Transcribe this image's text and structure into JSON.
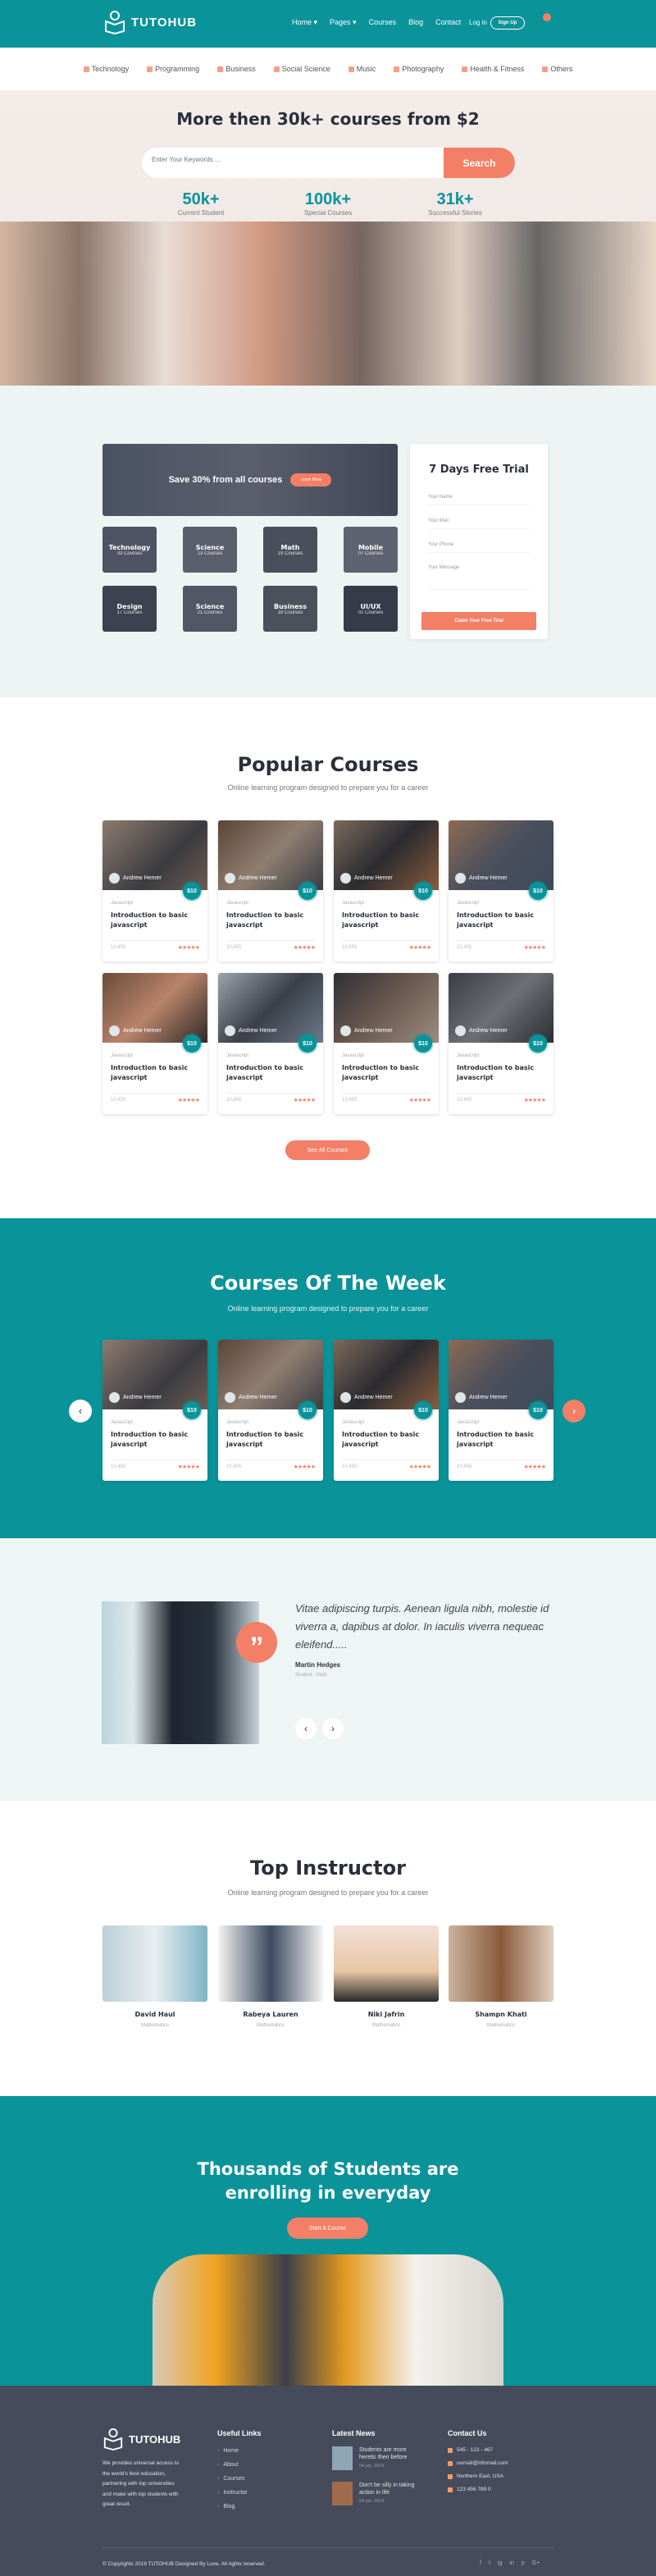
{
  "colors": {
    "teal": "#0a9399",
    "coral": "#f37f66",
    "footer": "#454b5a"
  },
  "header": {
    "logo": "TUTOHUB",
    "nav": [
      "Home ▾",
      "Pages ▾",
      "Courses",
      "Blog",
      "Contact"
    ],
    "login": "Log in",
    "signup": "Sign Up",
    "cart_icon": "cart-icon"
  },
  "categories": [
    {
      "label": "Technology",
      "icon": "laptop-icon"
    },
    {
      "label": "Programming",
      "icon": "monitor-icon"
    },
    {
      "label": "Business",
      "icon": "dollar-icon"
    },
    {
      "label": "Social Science",
      "icon": "globe-icon"
    },
    {
      "label": "Music",
      "icon": "music-icon"
    },
    {
      "label": "Photography",
      "icon": "camera-icon"
    },
    {
      "label": "Health & Fitness",
      "icon": "heart-icon"
    },
    {
      "label": "Others",
      "icon": "grid-icon"
    }
  ],
  "hero": {
    "title": "More then 30k+ courses from $2",
    "search_placeholder": "Enter Your Keywords ...",
    "search_button": "Search",
    "stats": [
      {
        "value": "50k+",
        "label": "Current Student"
      },
      {
        "value": "100k+",
        "label": "Special Courses"
      },
      {
        "value": "31k+",
        "label": "Successful Stories"
      }
    ]
  },
  "promo": {
    "banner_text": "Save 30% from all courses",
    "banner_button": "Learn More",
    "tiles": [
      {
        "name": "Technology",
        "count": "33 Courses"
      },
      {
        "name": "Science",
        "count": "13 Courses"
      },
      {
        "name": "Math",
        "count": "19 Courses"
      },
      {
        "name": "Mobile",
        "count": "07 Courses"
      },
      {
        "name": "Design",
        "count": "17 Courses"
      },
      {
        "name": "Science",
        "count": "21 Courses"
      },
      {
        "name": "Business",
        "count": "18 Courses"
      },
      {
        "name": "UI/UX",
        "count": "02 Courses"
      }
    ]
  },
  "trial": {
    "title": "7 Days Free Trial",
    "fields": [
      "Your Name",
      "Your Mail",
      "Your Phone",
      "Your Message"
    ],
    "button": "Claim Your Free Trial"
  },
  "popular": {
    "title": "Popular Courses",
    "subtitle": "Online learning program designed to prepare you for a career",
    "button": "See All Courses"
  },
  "course": {
    "author": "Andrew Hemer",
    "price": "$10",
    "category": "Javascript",
    "title": "Introduction to basic javascript",
    "students": "10,455",
    "stars": "★★★★★"
  },
  "week": {
    "title": "Courses Of The Week",
    "subtitle": "Online learning program designed to prepare you for a career"
  },
  "testimonial": {
    "quote": "Vitae adipiscing turpis. Aenean ligula nibh, molestie id viverra a, dapibus at dolor. In iaculis viverra nequeac eleifend.....",
    "name": "Martin Hedges",
    "role": "Student - Math"
  },
  "instructors": {
    "title": "Top Instructor",
    "subtitle": "Online learning program designed to prepare you for a career",
    "items": [
      {
        "name": "David Haul",
        "role": "Mathematics"
      },
      {
        "name": "Rabeya Lauren",
        "role": "Mathematics"
      },
      {
        "name": "Niki Jafrin",
        "role": "Mathematics"
      },
      {
        "name": "Shampn Khati",
        "role": "Mathematics"
      }
    ]
  },
  "cta": {
    "title_line1": "Thousands of Students are",
    "title_line2": "enrolling in everyday",
    "button": "Start A Course"
  },
  "footer": {
    "logo": "TUTOHUB",
    "about": "We provides universal access to the world's best education, partnering with top universities and make with top students with great result.",
    "links_title": "Useful Links",
    "links": [
      "Home",
      "About",
      "Courses",
      "Instructor",
      "Blog"
    ],
    "news_title": "Latest News",
    "news": [
      {
        "title": "Students are more heretic then before",
        "date": "04 jun, 2019"
      },
      {
        "title": "Don't be silly in taking action in life",
        "date": "04 jun, 2019"
      }
    ],
    "contact_title": "Contact Us",
    "contact": [
      {
        "icon": "phone-icon",
        "text": "545 - 123 - 467"
      },
      {
        "icon": "mail-icon",
        "text": "ournail@infomail.com"
      },
      {
        "icon": "location-icon",
        "text": "Northern East, USA"
      },
      {
        "icon": "fax-icon",
        "text": "123 456 789 0"
      }
    ],
    "copyright": "© Copyrights 2019 TUTOHUB Designed By Love. All rights reserved.",
    "social": [
      "f",
      "t",
      "ig",
      "in",
      "p",
      "G+"
    ]
  }
}
